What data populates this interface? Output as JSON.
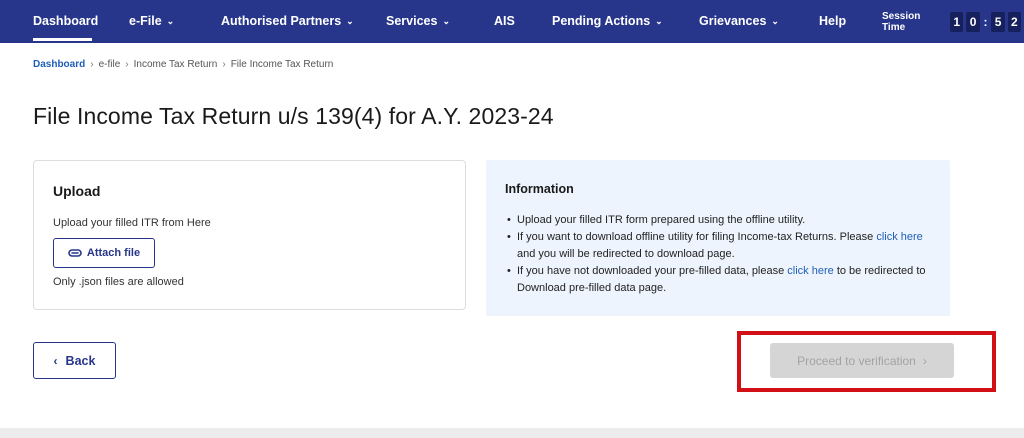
{
  "nav": {
    "items": [
      {
        "label": "Dashboard",
        "dropdown": false,
        "active": true
      },
      {
        "label": "e-File",
        "dropdown": true
      },
      {
        "label": "Authorised Partners",
        "dropdown": true
      },
      {
        "label": "Services",
        "dropdown": true
      },
      {
        "label": "AIS",
        "dropdown": false
      },
      {
        "label": "Pending Actions",
        "dropdown": true
      },
      {
        "label": "Grievances",
        "dropdown": true
      },
      {
        "label": "Help",
        "dropdown": false
      }
    ],
    "session_label": "Session Time",
    "session_digits": [
      "1",
      "0",
      "5",
      "2"
    ],
    "session_separator": ":"
  },
  "breadcrumb": {
    "items": [
      "Dashboard",
      "e-file",
      "Income Tax Return",
      "File Income Tax Return"
    ],
    "separator": "›"
  },
  "page_title": "File Income Tax Return u/s 139(4) for A.Y. 2023-24",
  "upload": {
    "title": "Upload",
    "description": "Upload your filled ITR from Here",
    "attach_label": "Attach file",
    "note": "Only .json files are allowed"
  },
  "information": {
    "title": "Information",
    "bullet1": "Upload your filled ITR form prepared using the offline utility.",
    "bullet2_pre": "If you want to download offline utility for filing Income-tax Returns. Please",
    "bullet2_link": "click here",
    "bullet2_post": "and you will be redirected to download page.",
    "bullet3_pre": "If you have not downloaded your pre-filled data, please",
    "bullet3_link": "click here",
    "bullet3_post": "to be redirected to Download pre-filled data page."
  },
  "buttons": {
    "back_label": "Back",
    "proceed_label": "Proceed to verification",
    "proceed_disabled": true
  },
  "colors": {
    "nav_bg": "#27368a",
    "link": "#1e5fb8",
    "highlight": "#d10f14",
    "info_bg": "#eef4fd"
  }
}
